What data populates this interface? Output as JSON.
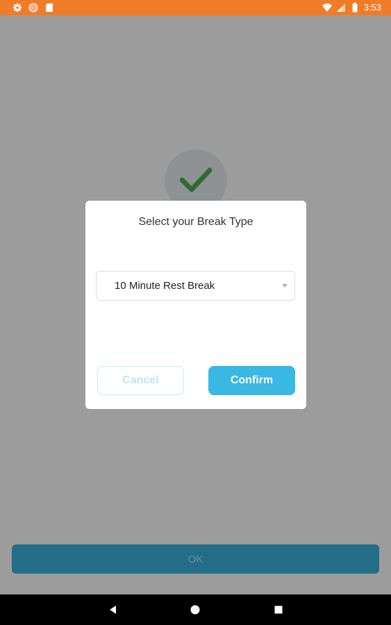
{
  "status_bar": {
    "time": "3:53",
    "left_icons": [
      "gear-icon",
      "circle-icon",
      "sd-card-icon"
    ],
    "right_icons": [
      "wifi-icon",
      "signal-icon",
      "battery-icon"
    ],
    "color": "#f07c28"
  },
  "background": {
    "check_icon": "check-icon",
    "ok_label": "OK",
    "ok_color": "#236d86"
  },
  "dialog": {
    "title": "Select your Break Type",
    "dropdown_value": "10 Minute Rest Break",
    "cancel_label": "Cancel",
    "confirm_label": "Confirm",
    "accent_color": "#39b8e3"
  },
  "nav_bar": {
    "buttons": [
      "back-icon",
      "home-icon",
      "recents-icon"
    ]
  }
}
